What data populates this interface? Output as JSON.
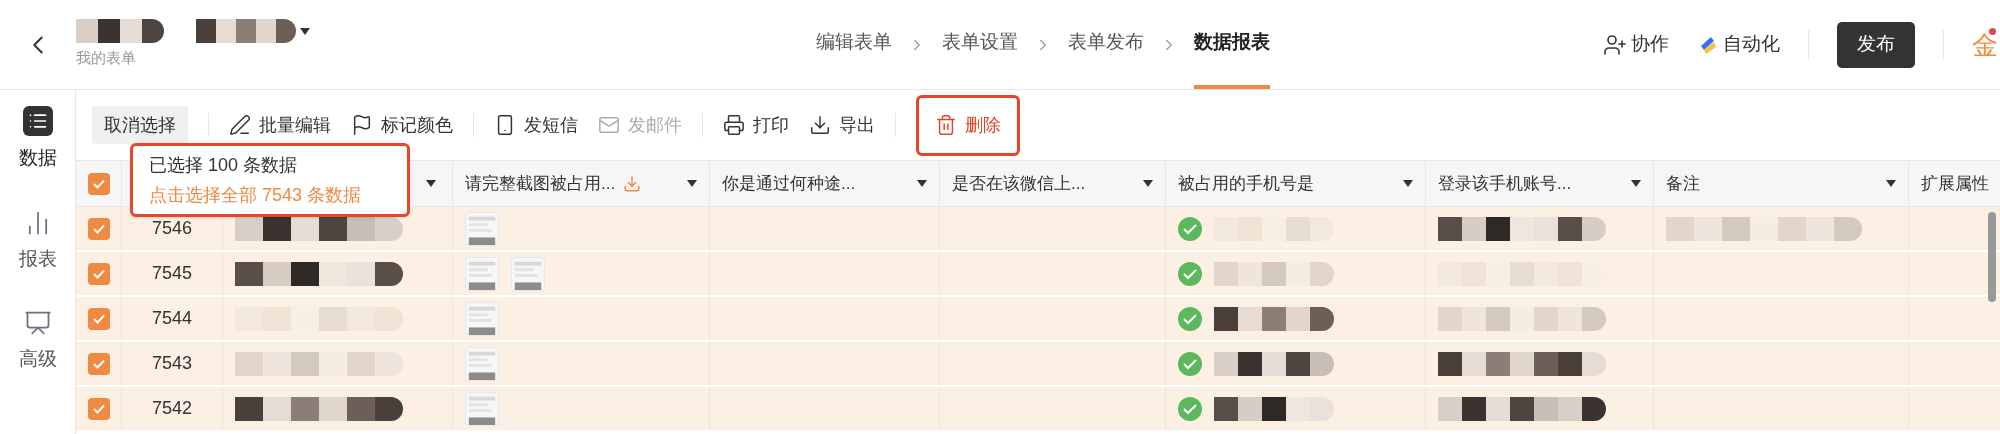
{
  "header": {
    "subtitle": "我的表单",
    "steps": [
      {
        "label": "编辑表单",
        "selected": false
      },
      {
        "label": "表单设置",
        "selected": false
      },
      {
        "label": "表单发布",
        "selected": false
      },
      {
        "label": "数据报表",
        "selected": true
      }
    ],
    "collaborate": "协作",
    "automation": "自动化",
    "publish": "发布",
    "logo": "金"
  },
  "sidebar": {
    "items": [
      {
        "label": "数据",
        "kind": "list",
        "selected": true
      },
      {
        "label": "报表",
        "kind": "chart",
        "selected": false
      },
      {
        "label": "高级",
        "kind": "presentation",
        "selected": false
      }
    ]
  },
  "toolbar": {
    "cancel": "取消选择",
    "actions": [
      {
        "label": "批量编辑",
        "kind": "edit",
        "disabled": false,
        "highlighted": false
      },
      {
        "label": "标记颜色",
        "kind": "flag",
        "disabled": false,
        "highlighted": false
      },
      {
        "label": "发短信",
        "kind": "phone",
        "disabled": false,
        "highlighted": false
      },
      {
        "label": "发邮件",
        "kind": "mail",
        "disabled": true,
        "highlighted": false
      },
      {
        "label": "打印",
        "kind": "print",
        "disabled": false,
        "highlighted": false
      },
      {
        "label": "导出",
        "kind": "export",
        "disabled": false,
        "highlighted": false
      },
      {
        "label": "删除",
        "kind": "delete",
        "disabled": false,
        "highlighted": true
      }
    ]
  },
  "selection_popover": {
    "count_text": "已选择 100 条数据",
    "select_all_link": "点击选择全部 7543 条数据"
  },
  "table": {
    "all_checked": true,
    "columns": [
      {
        "label": "请完整截图被占用...",
        "sort_icon": true
      },
      {
        "label": "你是通过何种途...",
        "sort_icon": false
      },
      {
        "label": "是否在该微信上...",
        "sort_icon": false
      },
      {
        "label": "被占用的手机号是",
        "sort_icon": false
      },
      {
        "label": "登录该手机账号...",
        "sort_icon": false
      },
      {
        "label": "备注",
        "sort_icon": false
      },
      {
        "label": "扩展属性",
        "sort_icon": false
      }
    ],
    "rows": [
      {
        "number": "7546",
        "checked": true
      },
      {
        "number": "7545",
        "checked": true
      },
      {
        "number": "7544",
        "checked": true
      },
      {
        "number": "7543",
        "checked": true
      },
      {
        "number": "7542",
        "checked": true
      }
    ]
  }
}
